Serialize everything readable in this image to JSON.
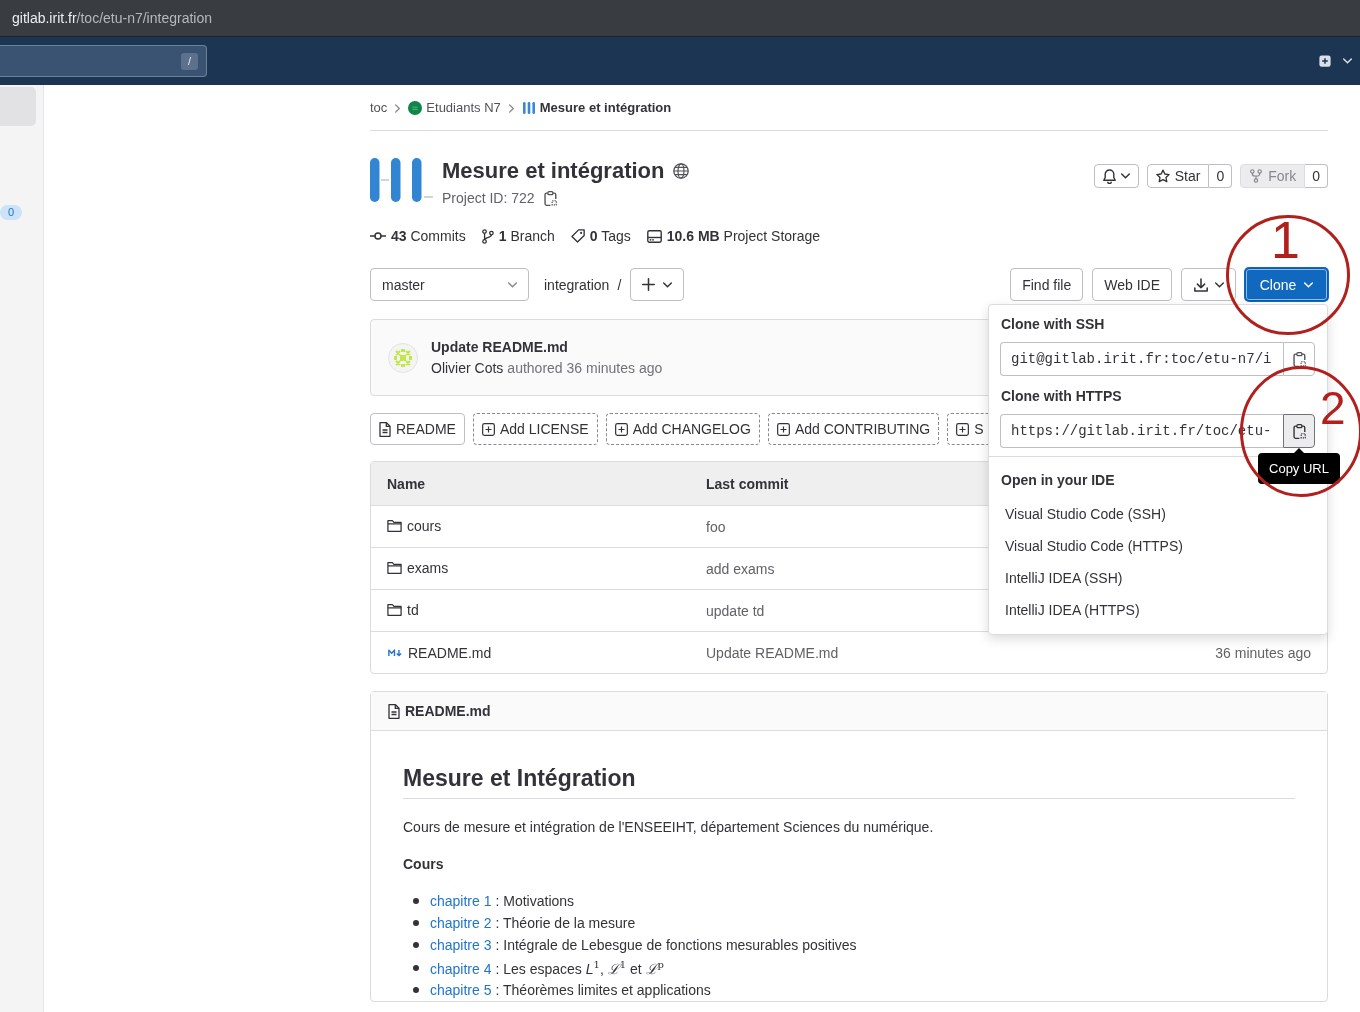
{
  "browser": {
    "url_host": "gitlab.irit.fr",
    "url_path": "/toc/etu-n7/integration"
  },
  "top_bar": {
    "search_shortcut": "/"
  },
  "sidebar": {
    "items": [
      {
        "selected": true
      },
      {
        "selected": false,
        "badge": "0"
      }
    ]
  },
  "breadcrumb": [
    {
      "label": "toc",
      "kind": "namespace",
      "current": false
    },
    {
      "label": "Etudiants N7",
      "kind": "group",
      "current": false
    },
    {
      "label": "Mesure et intégration",
      "kind": "project",
      "current": true
    }
  ],
  "project": {
    "name": "Mesure et intégration",
    "id_label": "Project ID: 722",
    "star": {
      "label": "Star",
      "count": "0",
      "disabled": false
    },
    "fork": {
      "label": "Fork",
      "count": "0",
      "disabled": true
    }
  },
  "stats": [
    {
      "kind": "commits",
      "text": "**43** Commits"
    },
    {
      "kind": "branches",
      "text": "**1** Branch"
    },
    {
      "kind": "tags",
      "text": "**0** Tags"
    },
    {
      "kind": "storage",
      "text": "**10.6 MB** Project Storage"
    }
  ],
  "repo_bar": {
    "branch": "master",
    "path": "integration",
    "separator": "/",
    "buttons": [
      "Find file",
      "Web IDE"
    ],
    "clone": {
      "label": "Clone",
      "expanded": true
    }
  },
  "last_commit": {
    "title": "Update README.md",
    "author": "Olivier Cots",
    "meta": "authored 36 minutes ago"
  },
  "quick_actions": [
    {
      "kind": "existing",
      "label": "README"
    },
    {
      "kind": "add",
      "label": "Add LICENSE"
    },
    {
      "kind": "add",
      "label": "Add CHANGELOG"
    },
    {
      "kind": "add",
      "label": "Add CONTRIBUTING"
    },
    {
      "kind": "add",
      "label": "S"
    }
  ],
  "files": {
    "columns": [
      "Name",
      "Last commit"
    ],
    "rows": [
      {
        "kind": "folder",
        "name": "cours",
        "commit": "foo"
      },
      {
        "kind": "folder",
        "name": "exams",
        "commit": "add exams"
      },
      {
        "kind": "folder",
        "name": "td",
        "commit": "update td"
      },
      {
        "kind": "markdown",
        "name": "README.md",
        "commit": "Update README.md",
        "updated": "36 minutes ago"
      }
    ]
  },
  "clone_dropdown": {
    "sections": [
      {
        "title": "Clone with SSH",
        "url": "git@gitlab.irit.fr:toc/etu-n7/i",
        "focused": false
      },
      {
        "title": "Clone with HTTPS",
        "url": "https://gitlab.irit.fr/toc/etu-",
        "focused": true
      }
    ],
    "tooltip": "Copy URL",
    "ide_title": "Open in your IDE",
    "ide_items": [
      "Visual Studio Code (SSH)",
      "Visual Studio Code (HTTPS)",
      "IntelliJ IDEA (SSH)",
      "IntelliJ IDEA (HTTPS)"
    ]
  },
  "readme": {
    "filename": "README.md",
    "heading": "Mesure et Intégration",
    "intro": "Cours de mesure et intégration de l'ENSEEIHT, département Sciences du numérique.",
    "section": "Cours",
    "chapters": [
      {
        "link": "chapitre 1",
        "text": ": Motivations"
      },
      {
        "link": "chapitre 2",
        "text": ": Théorie de la mesure"
      },
      {
        "link": "chapitre 3",
        "text": ": Intégrale de Lebesgue de fonctions mesurables positives"
      },
      {
        "link": "chapitre 4",
        "text": ": Les espaces *L*$^{1}$, *ℒ*$^{1}$ et *ℒ*$^{p}$"
      },
      {
        "link": "chapitre 5",
        "text": ": Théorèmes limites et applications"
      }
    ]
  },
  "annotations": [
    {
      "label": "1"
    },
    {
      "label": "2"
    }
  ]
}
